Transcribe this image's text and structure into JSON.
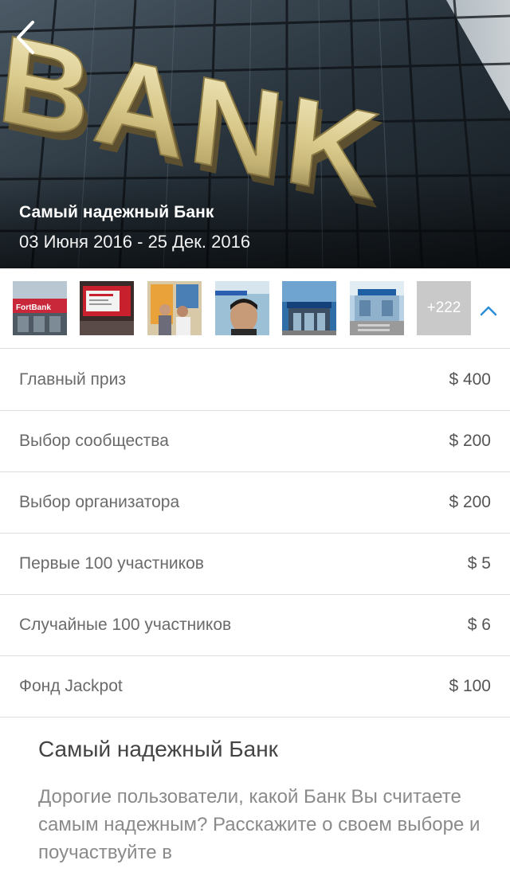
{
  "hero": {
    "sign_text": "BANK",
    "title": "Самый надежный Банк",
    "dates": "03 Июня 2016 - 25 Дек. 2016"
  },
  "gallery": {
    "thumbnails": [
      {
        "subject": "bank-storefront-red-sign",
        "sign_text": "FortBank"
      },
      {
        "subject": "bank-interior-red-screen"
      },
      {
        "subject": "people-at-bank-counter"
      },
      {
        "subject": "selfie-at-bank"
      },
      {
        "subject": "bank-building-entrance"
      },
      {
        "subject": "bank-branch-steps"
      }
    ],
    "more_count": "+222",
    "collapse_icon": "chevron-up-icon"
  },
  "prizes": [
    {
      "label": "Главный приз",
      "amount": "$ 400"
    },
    {
      "label": "Выбор сообщества",
      "amount": "$ 200"
    },
    {
      "label": "Выбор организатора",
      "amount": "$ 200"
    },
    {
      "label": "Первые 100 участников",
      "amount": "$ 5"
    },
    {
      "label": "Случайные 100 участников",
      "amount": "$ 6"
    },
    {
      "label": "Фонд Jackpot",
      "amount": "$ 100"
    }
  ],
  "description": {
    "title": "Самый надежный Банк",
    "text": "Дорогие пользователи,  какой Банк Вы считаете самым надежным? Расскажите о своем выборе и поучаствуйте в"
  },
  "colors": {
    "accent": "#2a8fd6",
    "divider": "#dedede",
    "more_tile": "#c9c9c9"
  }
}
